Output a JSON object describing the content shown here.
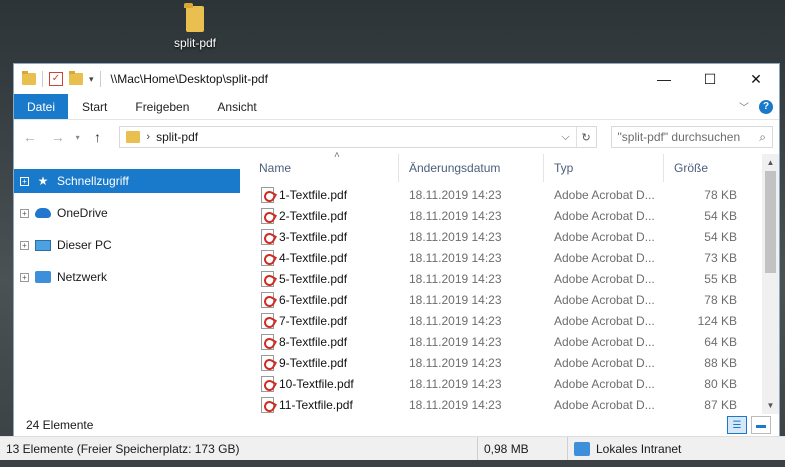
{
  "desktop": {
    "icon_label": "split-pdf"
  },
  "window": {
    "title_path": "\\\\Mac\\Home\\Desktop\\split-pdf",
    "controls": {
      "minimize": "—",
      "maximize": "☐",
      "close": "✕"
    }
  },
  "ribbon": {
    "tabs": [
      {
        "label": "Datei"
      },
      {
        "label": "Start"
      },
      {
        "label": "Freigeben"
      },
      {
        "label": "Ansicht"
      }
    ],
    "help": "?"
  },
  "nav": {
    "address_folder": "split-pdf",
    "search_placeholder": "\"split-pdf\" durchsuchen"
  },
  "sidebar": {
    "items": [
      {
        "label": "Schnellzugriff"
      },
      {
        "label": "OneDrive"
      },
      {
        "label": "Dieser PC"
      },
      {
        "label": "Netzwerk"
      }
    ]
  },
  "columns": {
    "name": "Name",
    "date": "Änderungsdatum",
    "type": "Typ",
    "size": "Größe"
  },
  "files": [
    {
      "name": "1-Textfile.pdf",
      "date": "18.11.2019 14:23",
      "type": "Adobe Acrobat D...",
      "size": "78 KB"
    },
    {
      "name": "2-Textfile.pdf",
      "date": "18.11.2019 14:23",
      "type": "Adobe Acrobat D...",
      "size": "54 KB"
    },
    {
      "name": "3-Textfile.pdf",
      "date": "18.11.2019 14:23",
      "type": "Adobe Acrobat D...",
      "size": "54 KB"
    },
    {
      "name": "4-Textfile.pdf",
      "date": "18.11.2019 14:23",
      "type": "Adobe Acrobat D...",
      "size": "73 KB"
    },
    {
      "name": "5-Textfile.pdf",
      "date": "18.11.2019 14:23",
      "type": "Adobe Acrobat D...",
      "size": "55 KB"
    },
    {
      "name": "6-Textfile.pdf",
      "date": "18.11.2019 14:23",
      "type": "Adobe Acrobat D...",
      "size": "78 KB"
    },
    {
      "name": "7-Textfile.pdf",
      "date": "18.11.2019 14:23",
      "type": "Adobe Acrobat D...",
      "size": "124 KB"
    },
    {
      "name": "8-Textfile.pdf",
      "date": "18.11.2019 14:23",
      "type": "Adobe Acrobat D...",
      "size": "64 KB"
    },
    {
      "name": "9-Textfile.pdf",
      "date": "18.11.2019 14:23",
      "type": "Adobe Acrobat D...",
      "size": "88 KB"
    },
    {
      "name": "10-Textfile.pdf",
      "date": "18.11.2019 14:23",
      "type": "Adobe Acrobat D...",
      "size": "80 KB"
    },
    {
      "name": "11-Textfile.pdf",
      "date": "18.11.2019 14:23",
      "type": "Adobe Acrobat D...",
      "size": "87 KB"
    }
  ],
  "item_count": "24 Elemente",
  "status": {
    "left": "13 Elemente (Freier Speicherplatz: 173 GB)",
    "size": "0,98 MB",
    "zone": "Lokales Intranet"
  }
}
